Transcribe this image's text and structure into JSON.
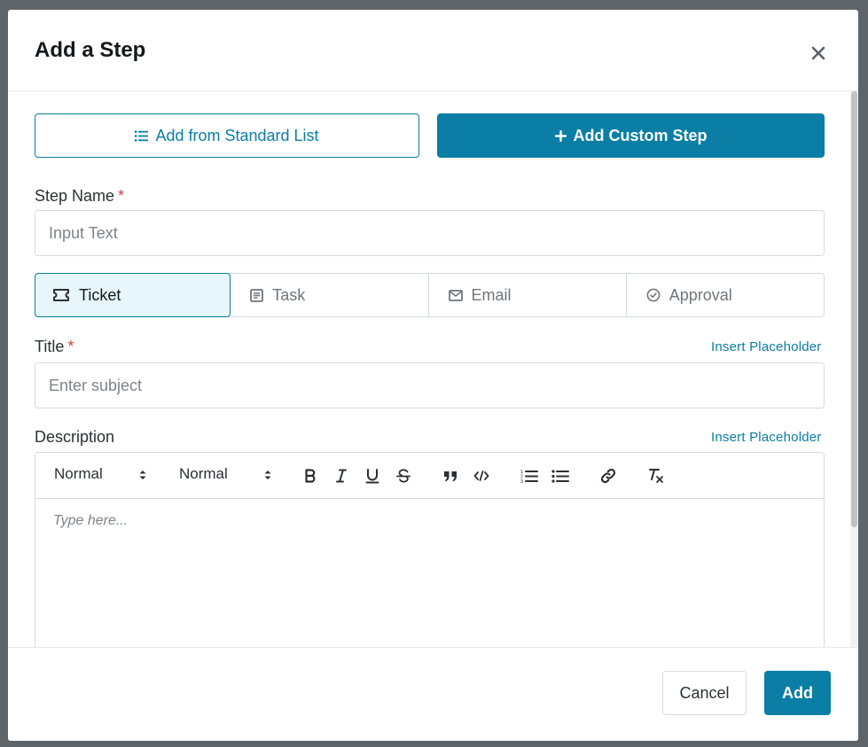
{
  "modal": {
    "title": "Add a Step",
    "close_icon": "close-icon"
  },
  "actions": {
    "standard_list_label": "Add from Standard List",
    "custom_step_label": "Add Custom Step"
  },
  "step_name": {
    "label": "Step Name",
    "required_mark": "*",
    "placeholder": "Input Text",
    "value": ""
  },
  "step_types": [
    {
      "label": "Ticket",
      "icon": "ticket-icon",
      "selected": true
    },
    {
      "label": "Task",
      "icon": "task-icon",
      "selected": false
    },
    {
      "label": "Email",
      "icon": "email-icon",
      "selected": false
    },
    {
      "label": "Approval",
      "icon": "check-circle-icon",
      "selected": false
    }
  ],
  "title_field": {
    "label": "Title",
    "required_mark": "*",
    "insert_placeholder": "Insert Placeholder",
    "placeholder": "Enter subject",
    "value": ""
  },
  "description": {
    "label": "Description",
    "insert_placeholder": "Insert Placeholder",
    "toolbar": {
      "header_select": "Normal",
      "size_select": "Normal",
      "buttons": [
        "bold-icon",
        "italic-icon",
        "underline-icon",
        "strike-icon",
        "blockquote-icon",
        "code-icon",
        "ordered-list-icon",
        "bullet-list-icon",
        "link-icon",
        "clear-format-icon"
      ]
    },
    "placeholder": "Type here..."
  },
  "footer": {
    "cancel_label": "Cancel",
    "add_label": "Add"
  },
  "colors": {
    "accent": "#0a7ea4",
    "required": "#d63a3a",
    "selected_bg": "#e6f6fb"
  }
}
